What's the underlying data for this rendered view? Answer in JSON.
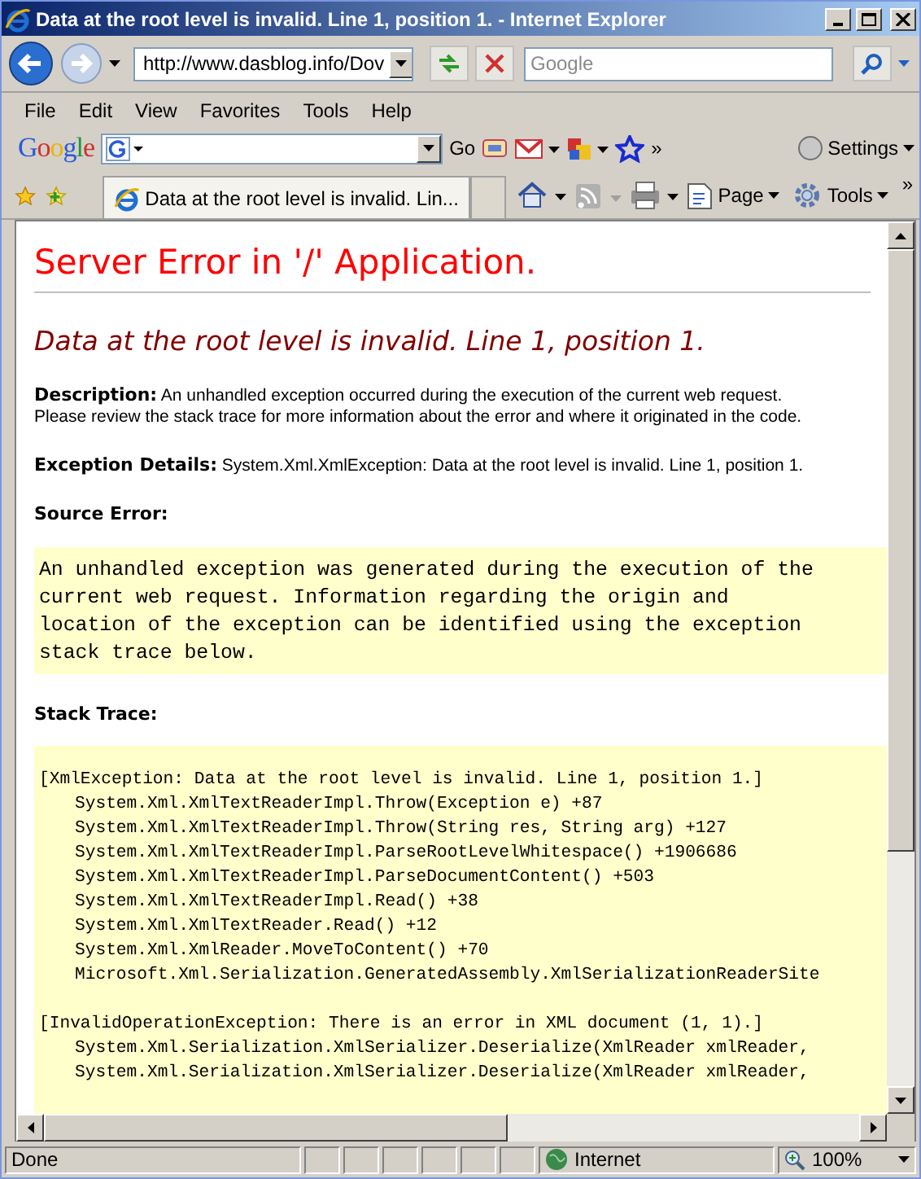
{
  "window": {
    "title": "Data at the root level is invalid. Line 1, position 1. - Internet Explorer"
  },
  "address_bar": {
    "url": "http://www.dasblog.info/Dov",
    "search_placeholder": "Google"
  },
  "menu": [
    "File",
    "Edit",
    "View",
    "Favorites",
    "Tools",
    "Help"
  ],
  "google_bar": {
    "logo": "Google",
    "go": "Go",
    "more": "»",
    "settings": "Settings"
  },
  "tabs": [
    {
      "title": "Data at the root level is invalid. Lin...",
      "selected": true
    }
  ],
  "command_bar": {
    "page": "Page",
    "tools": "Tools",
    "more": "»"
  },
  "content": {
    "heading": "Server Error in '/' Application.",
    "subheading": "Data at the root level is invalid. Line 1, position 1.",
    "description": "**Description:** An unhandled exception occurred during the execution of the current web request.\nPlease review the stack trace for more information about the error and where it originated in the code.",
    "exception_details": "**Exception Details:** System.Xml.XmlException: Data at the root level is invalid. Line 1, position 1.",
    "source_error_label": "Source Error:",
    "source_error": [
      "An unhandled exception was generated during the execution of the",
      "current web request. Information regarding the origin and",
      "location of the exception can be identified using the exception",
      "stack trace below."
    ],
    "stack_trace_label": "Stack Trace:",
    "stack_trace": [
      {
        "header": "[XmlException: Data at the root level is invalid. Line 1, position 1.]",
        "frames": [
          "System.Xml.XmlTextReaderImpl.Throw(Exception e) +87",
          "System.Xml.XmlTextReaderImpl.Throw(String res, String arg) +127",
          "System.Xml.XmlTextReaderImpl.ParseRootLevelWhitespace() +1906686",
          "System.Xml.XmlTextReaderImpl.ParseDocumentContent() +503",
          "System.Xml.XmlTextReaderImpl.Read() +38",
          "System.Xml.XmlTextReader.Read() +12",
          "System.Xml.XmlReader.MoveToContent() +70",
          "Microsoft.Xml.Serialization.GeneratedAssembly.XmlSerializationReaderSite"
        ]
      },
      {
        "header": "[InvalidOperationException: There is an error in XML document (1, 1).]",
        "frames": [
          "System.Xml.Serialization.XmlSerializer.Deserialize(XmlReader xmlReader,",
          "System.Xml.Serialization.XmlSerializer.Deserialize(XmlReader xmlReader,"
        ]
      }
    ]
  },
  "status_bar": {
    "status": "Done",
    "zone": "Internet",
    "zoom": "100%"
  }
}
